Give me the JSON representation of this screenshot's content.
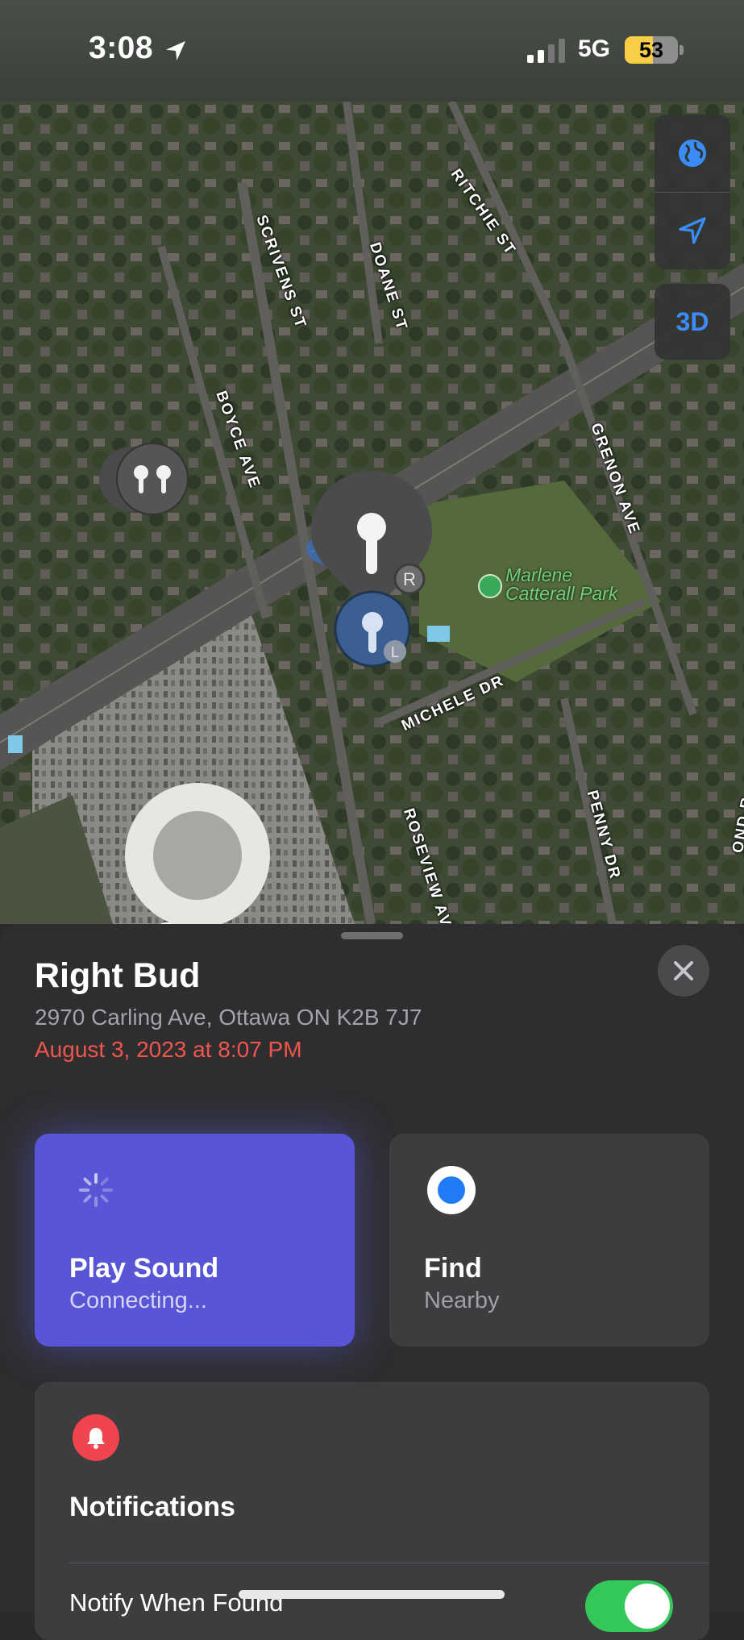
{
  "status_bar": {
    "time": "3:08",
    "network": "5G",
    "battery": "53",
    "battery_level_percent": 53,
    "battery_color": "#f7ce45",
    "icons": [
      "location-arrow-icon",
      "cellular-signal-icon"
    ]
  },
  "map": {
    "streets": [
      "RITCHIE ST",
      "SCRIVENS ST",
      "DOANE ST",
      "BOYCE AVE",
      "GRENON AVE",
      "MICHELE DR",
      "ROSEVIEW AV",
      "PENNY DR",
      "OND R"
    ],
    "park_name_line1": "Marlene",
    "park_name_line2": "Catterall Park",
    "park_color": "#6fd07d",
    "controls": {
      "globe_icon": "globe-icon",
      "location_icon": "location-arrow-icon",
      "three_d_label": "3D",
      "accent": "#3b8cf7"
    },
    "pins": {
      "right_badge": "R",
      "left_badge": "L"
    }
  },
  "sheet": {
    "title": "Right Bud",
    "address": "2970 Carling Ave, Ottawa ON K2B 7J7",
    "timestamp": "August 3, 2023 at 8:07 PM",
    "timestamp_color": "#f2554b",
    "play_sound": {
      "title": "Play Sound",
      "subtitle": "Connecting...",
      "color": "#5856d6"
    },
    "find": {
      "title": "Find",
      "subtitle": "Nearby",
      "dot_color": "#1f7bf6"
    },
    "notifications": {
      "title": "Notifications",
      "notify_label": "Notify When Found",
      "notify_enabled": true,
      "toggle_color": "#34c759",
      "bell_color": "#f0444e"
    }
  }
}
